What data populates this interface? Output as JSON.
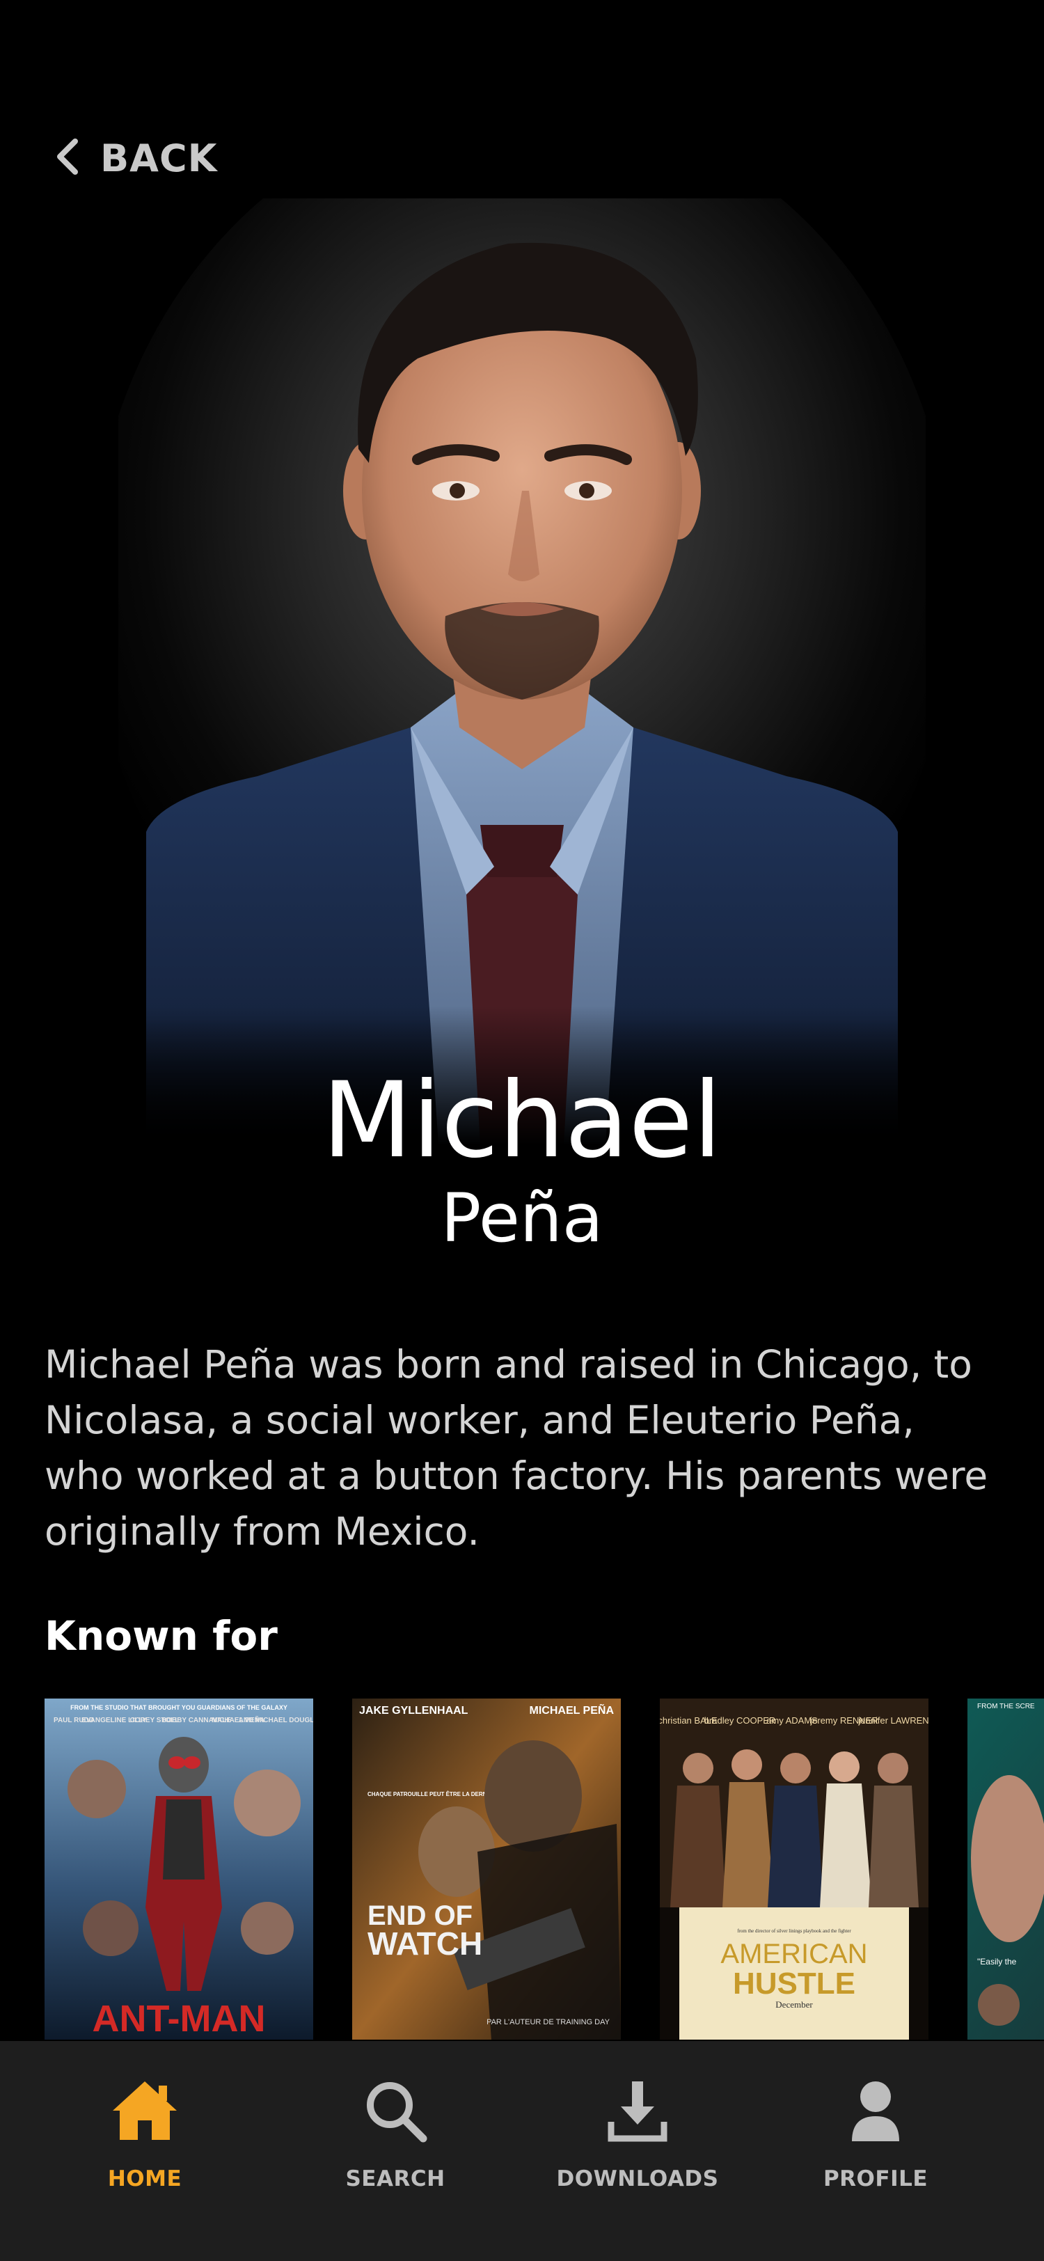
{
  "header": {
    "back_label": "BACK"
  },
  "person": {
    "first_name": "Michael",
    "last_name": "Peña",
    "bio": "Michael Peña was born and raised in Chicago, to Nicolasa, a social worker, and Eleuterio Peña, who worked at a button factory. His parents were originally from Mexico."
  },
  "known_for": {
    "title": "Known for",
    "posters": [
      {
        "title": "ANT-MAN",
        "top_text": "FROM THE STUDIO THAT BROUGHT YOU GUARDIANS OF THE GALAXY",
        "cast": [
          "PAUL RUDD",
          "EVANGELINE LILLY",
          "COREY STOLL",
          "BOBBY CANNAVALE",
          "MICHAEL PEÑA",
          "AND MICHAEL DOUGLAS"
        ]
      },
      {
        "title_line1": "END OF",
        "title_line2": "WATCH",
        "cast_left": "JAKE GYLLENHAAL",
        "cast_right": "MICHAEL PEÑA",
        "tagline": "CHAQUE PATROUILLE PEUT ÊTRE LA DERNIÈRE",
        "credit": "PAR L'AUTEUR DE TRAINING DAY"
      },
      {
        "title_line1": "AMERICAN",
        "title_line2": "HUSTLE",
        "cast": [
          "christian BALE",
          "bradley COOPER",
          "amy ADAMS",
          "jeremy RENNER",
          "jennifer LAWRENCE"
        ],
        "director_credit": "from the director of silver linings playbook and the fighter",
        "release": "December"
      },
      {
        "top_text": "FROM THE SCRE",
        "quote": "\"Easily the"
      }
    ]
  },
  "nav": {
    "items": [
      {
        "label": "HOME",
        "icon": "home-icon",
        "active": true
      },
      {
        "label": "SEARCH",
        "icon": "search-icon",
        "active": false
      },
      {
        "label": "DOWNLOADS",
        "icon": "download-icon",
        "active": false
      },
      {
        "label": "PROFILE",
        "icon": "profile-icon",
        "active": false
      }
    ]
  },
  "colors": {
    "accent": "#f5a623",
    "background": "#000000",
    "nav_background": "#1e1e1e",
    "nav_inactive": "#bdbdbd"
  }
}
